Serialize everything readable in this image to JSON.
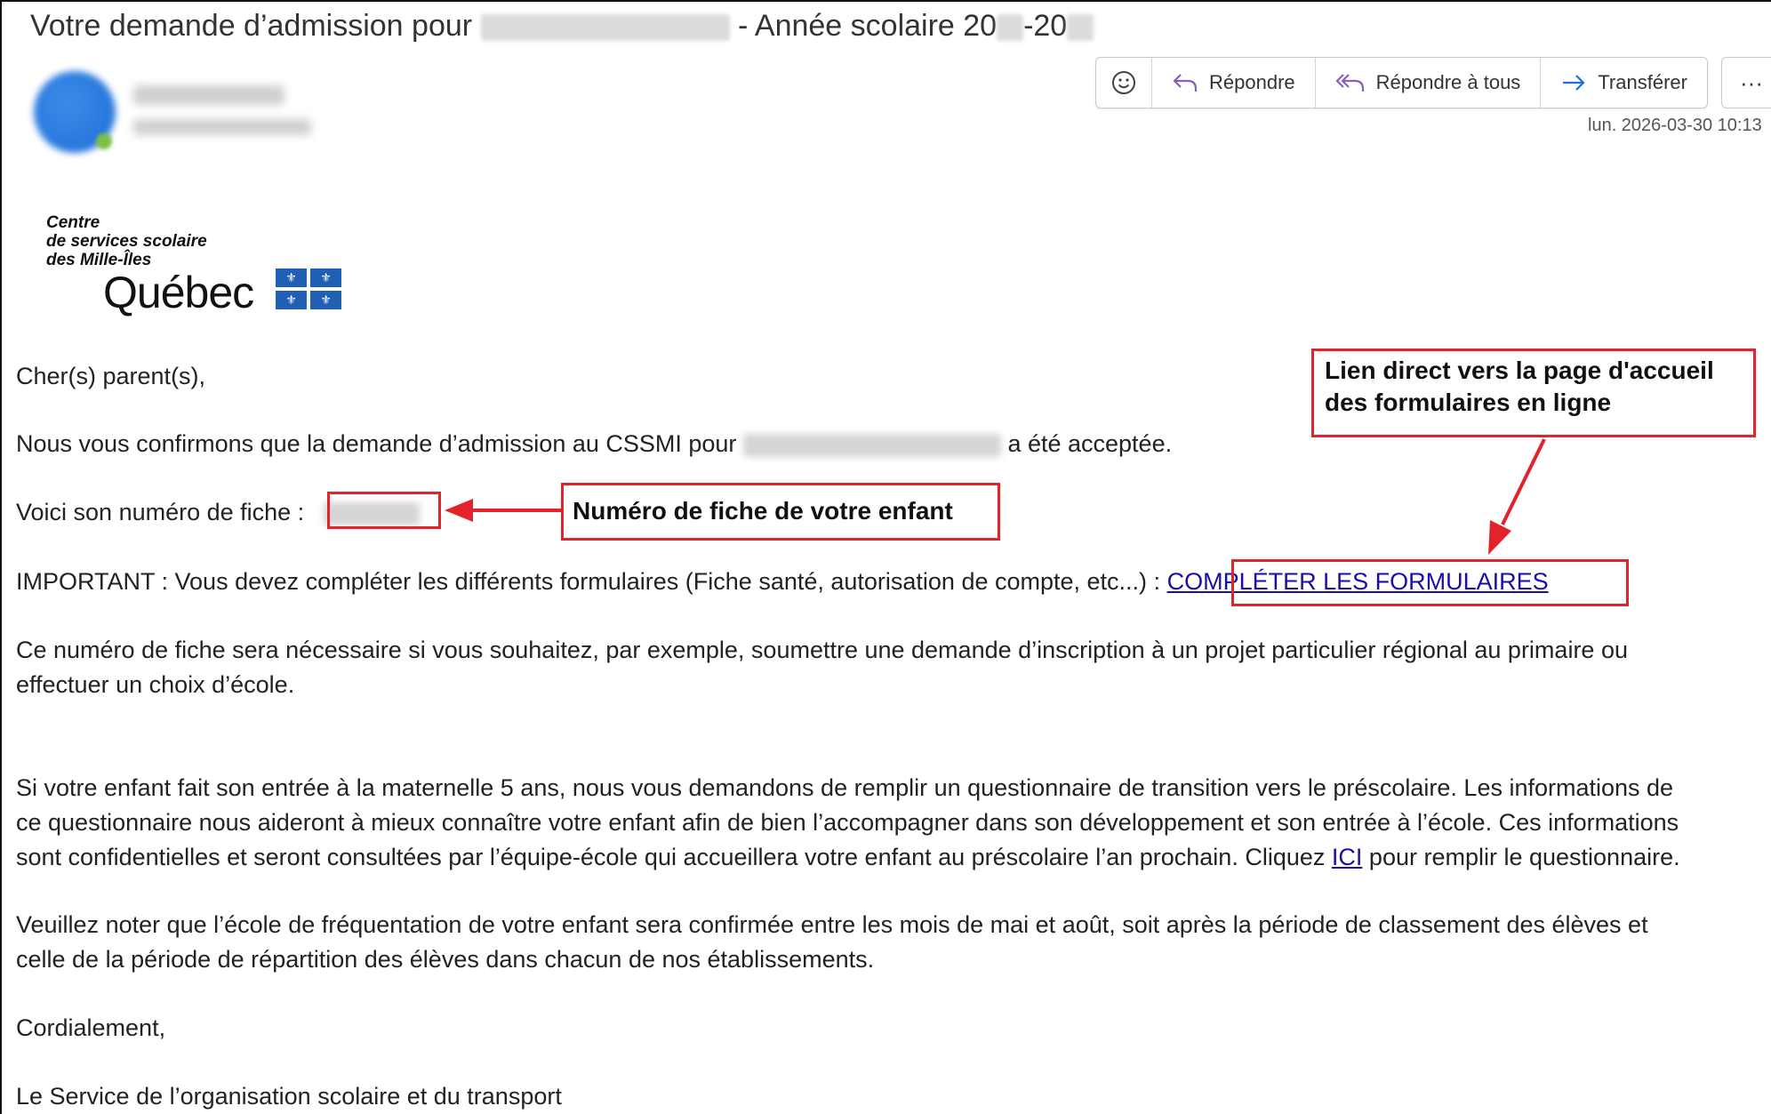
{
  "email": {
    "subject_prefix": "Votre demande d’admission pour",
    "subject_sep": "- Année scolaire 20",
    "subject_dash": "-20",
    "date": "lun. 2026-03-30 10:13"
  },
  "toolbar": {
    "reply": "Répondre",
    "reply_all": "Répondre à tous",
    "forward": "Transférer",
    "more": "···"
  },
  "logo": {
    "line1": "Centre",
    "line2": "de services scolaire",
    "line3": "des Mille-Îles",
    "brand": "Québec"
  },
  "body": {
    "greeting": "Cher(s) parent(s),",
    "confirm_a": "Nous vous confirmons que la demande d’admission au CSSMI pour",
    "confirm_b": "a été acceptée.",
    "fiche_label": "Voici son numéro de fiche :",
    "important": "IMPORTANT : Vous devez compléter les différents formulaires (Fiche santé, autorisation de compte, etc...) :",
    "forms_link": "COMPLÉTER LES FORMULAIRES",
    "fiche_usage_1": "Ce numéro de fiche sera nécessaire si vous souhaitez, par exemple, soumettre une demande d’inscription à un projet particulier régional au primaire ou",
    "fiche_usage_2": "effectuer un choix d’école.",
    "maternelle_1": "Si votre enfant fait son entrée à la maternelle 5 ans, nous vous demandons de remplir un questionnaire de transition vers le préscolaire. Les informations de",
    "maternelle_2": "ce questionnaire nous aideront à mieux connaître votre enfant afin de bien l’accompagner dans son développement et son entrée à l’école. Ces informations",
    "maternelle_3a": "sont confidentielles et seront consultées par l’équipe-école qui accueillera votre enfant au préscolaire l’an prochain. Cliquez",
    "ici_link": "ICI",
    "maternelle_3b": "pour remplir le questionnaire.",
    "note_1": "Veuillez noter que l’école de fréquentation de votre enfant sera confirmée entre les mois de mai et août, soit après la période de classement des élèves et",
    "note_2": "celle de la période de répartition des élèves dans chacun de nos établissements.",
    "closing": "Cordialement,",
    "signature": "Le Service de l’organisation scolaire et du transport"
  },
  "annotations": {
    "fiche_callout": "Numéro de fiche de votre enfant",
    "link_callout_1": "Lien direct vers la page d'accueil",
    "link_callout_2": "des formulaires en ligne",
    "accent_color": "#e2232a"
  }
}
